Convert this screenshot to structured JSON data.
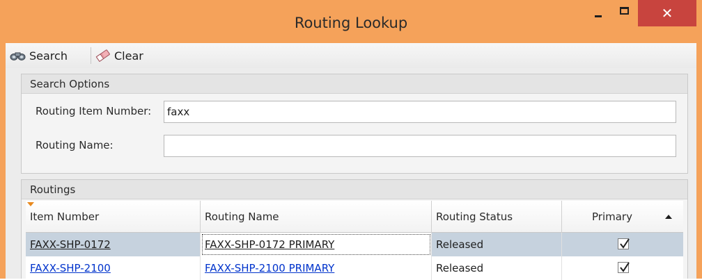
{
  "window": {
    "title": "Routing Lookup",
    "close_glyph": "✕"
  },
  "toolbar": {
    "search_label": "Search",
    "clear_label": "Clear",
    "search_icon": "binoculars-icon",
    "clear_icon": "eraser-icon"
  },
  "search_options": {
    "header": "Search Options",
    "item_number_label": "Routing Item Number:",
    "item_number_value": "faxx",
    "name_label": "Routing Name:",
    "name_value": ""
  },
  "routings": {
    "header": "Routings",
    "columns": [
      "Item Number",
      "Routing Name",
      "Routing Status",
      "Primary"
    ],
    "rows": [
      {
        "item_number": "FAXX-SHP-0172",
        "routing_name": "FAXX-SHP-0172 PRIMARY",
        "status": "Released",
        "primary": true
      },
      {
        "item_number": "FAXX-SHP-2100",
        "routing_name": "FAXX-SHP-2100 PRIMARY",
        "status": "Released",
        "primary": true
      }
    ]
  },
  "colors": {
    "window_frame": "#f5a25a",
    "close_button": "#c8443e",
    "selected_row": "#c6d2de",
    "link": "#0033cc"
  }
}
